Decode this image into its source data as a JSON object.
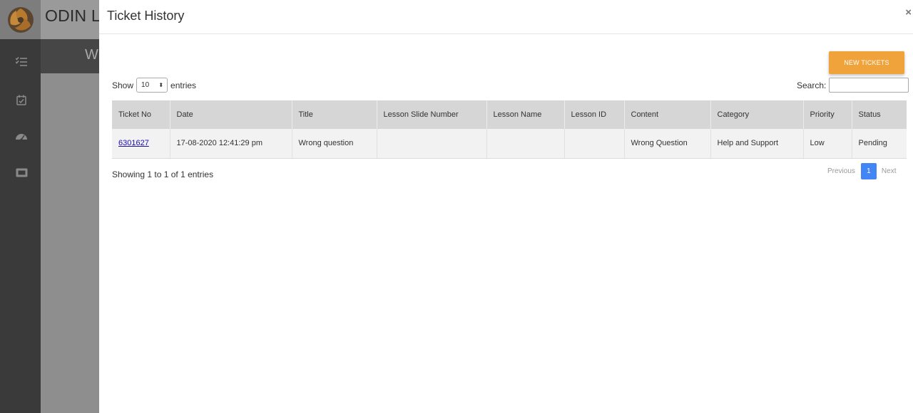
{
  "app": {
    "title": "ODIN LE",
    "subtitle": "W"
  },
  "modal": {
    "title": "Ticket History",
    "close_glyph": "×",
    "new_tickets_label": "NEW TICKETS",
    "show_label": "Show",
    "entries_value": "10",
    "entries_label": "entries",
    "search_label": "Search:",
    "search_value": ""
  },
  "table": {
    "columns": [
      "Ticket No",
      "Date",
      "Title",
      "Lesson Slide Number",
      "Lesson Name",
      "Lesson ID",
      "Content",
      "Category",
      "Priority",
      "Status"
    ],
    "rows": [
      {
        "ticket_no": "6301627",
        "date": "17-08-2020 12:41:29 pm",
        "title": "Wrong question",
        "lesson_slide_number": "",
        "lesson_name": "",
        "lesson_id": "",
        "content": "Wrong Question",
        "category": "Help and Support",
        "priority": "Low",
        "status": "Pending"
      }
    ]
  },
  "footer": {
    "info": "Showing 1 to 1 of 1 entries",
    "previous": "Previous",
    "current_page": "1",
    "next": "Next"
  },
  "colors": {
    "accent_button": "#f0a23b",
    "active_page": "#4285f4",
    "link": "#1a0dab"
  },
  "icons": [
    "logo-icon",
    "checklist-icon",
    "calendar-check-icon",
    "dashboard-gauge-icon",
    "ticket-icon"
  ]
}
